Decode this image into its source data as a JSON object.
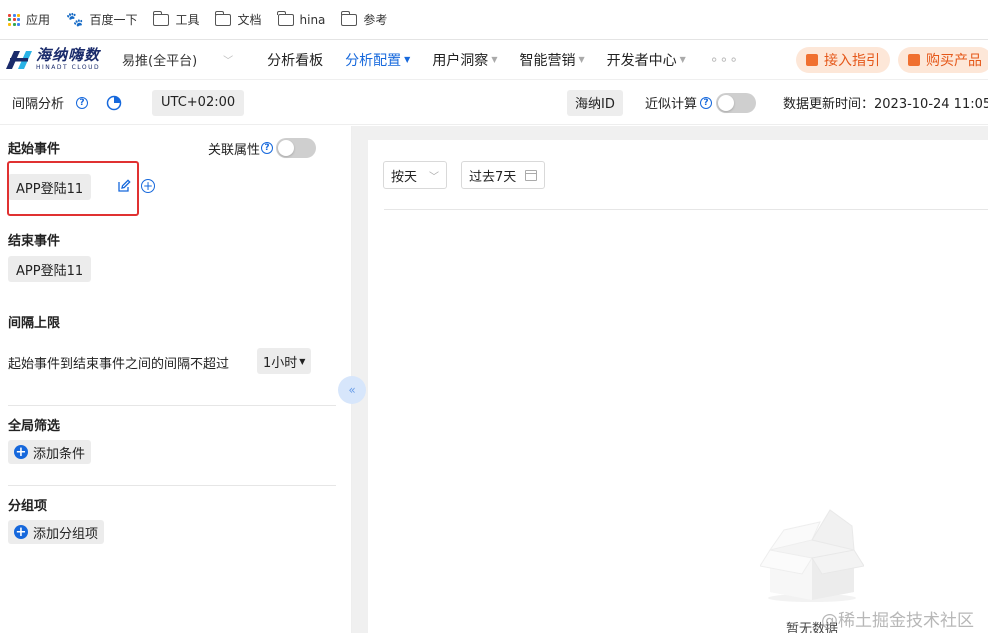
{
  "bookmarks": [
    {
      "label": "应用",
      "icon": "apps-grid-icon"
    },
    {
      "label": "百度一下",
      "icon": "baidu-paw-icon"
    },
    {
      "label": "工具",
      "icon": "folder-icon"
    },
    {
      "label": "文档",
      "icon": "folder-icon"
    },
    {
      "label": "hina",
      "icon": "folder-icon"
    },
    {
      "label": "参考",
      "icon": "folder-icon"
    }
  ],
  "brand": {
    "name_cn": "海纳嗨数",
    "name_en": "HINADT CLOUD",
    "color": "#1a2b6b"
  },
  "project": {
    "label": "易推(全平台)"
  },
  "nav": {
    "items": [
      {
        "label": "分析看板",
        "dropdown": false,
        "active": false
      },
      {
        "label": "分析配置",
        "dropdown": true,
        "active": true
      },
      {
        "label": "用户洞察",
        "dropdown": true,
        "active": false
      },
      {
        "label": "智能营销",
        "dropdown": true,
        "active": false
      },
      {
        "label": "开发者中心",
        "dropdown": true,
        "active": false
      }
    ],
    "more": "∘∘∘",
    "guide_label": "接入指引",
    "buy_label": "购买产品"
  },
  "toolbar": {
    "title": "间隔分析",
    "timezone": "UTC+02:00",
    "id_type": "海纳ID",
    "approx_label": "近似计算",
    "update_time": "数据更新时间：2023-10-24 11:05"
  },
  "left": {
    "start_title": "起始事件",
    "assoc_label": "关联属性",
    "start_event": "APP登陆11",
    "end_title": "结束事件",
    "end_event": "APP登陆11",
    "limit_title": "间隔上限",
    "limit_text": "起始事件到结束事件之间的间隔不超过",
    "limit_value": "1小时",
    "filter_title": "全局筛选",
    "add_condition": "添加条件",
    "group_title": "分组项",
    "add_group": "添加分组项"
  },
  "right": {
    "granularity": "按天",
    "range": "过去7天",
    "empty_text": "暂无数据",
    "watermark": "@稀土掘金技术社区"
  },
  "colors": {
    "accent": "#1668dc",
    "highlight": "#e03131",
    "orange": "#e5581a"
  }
}
